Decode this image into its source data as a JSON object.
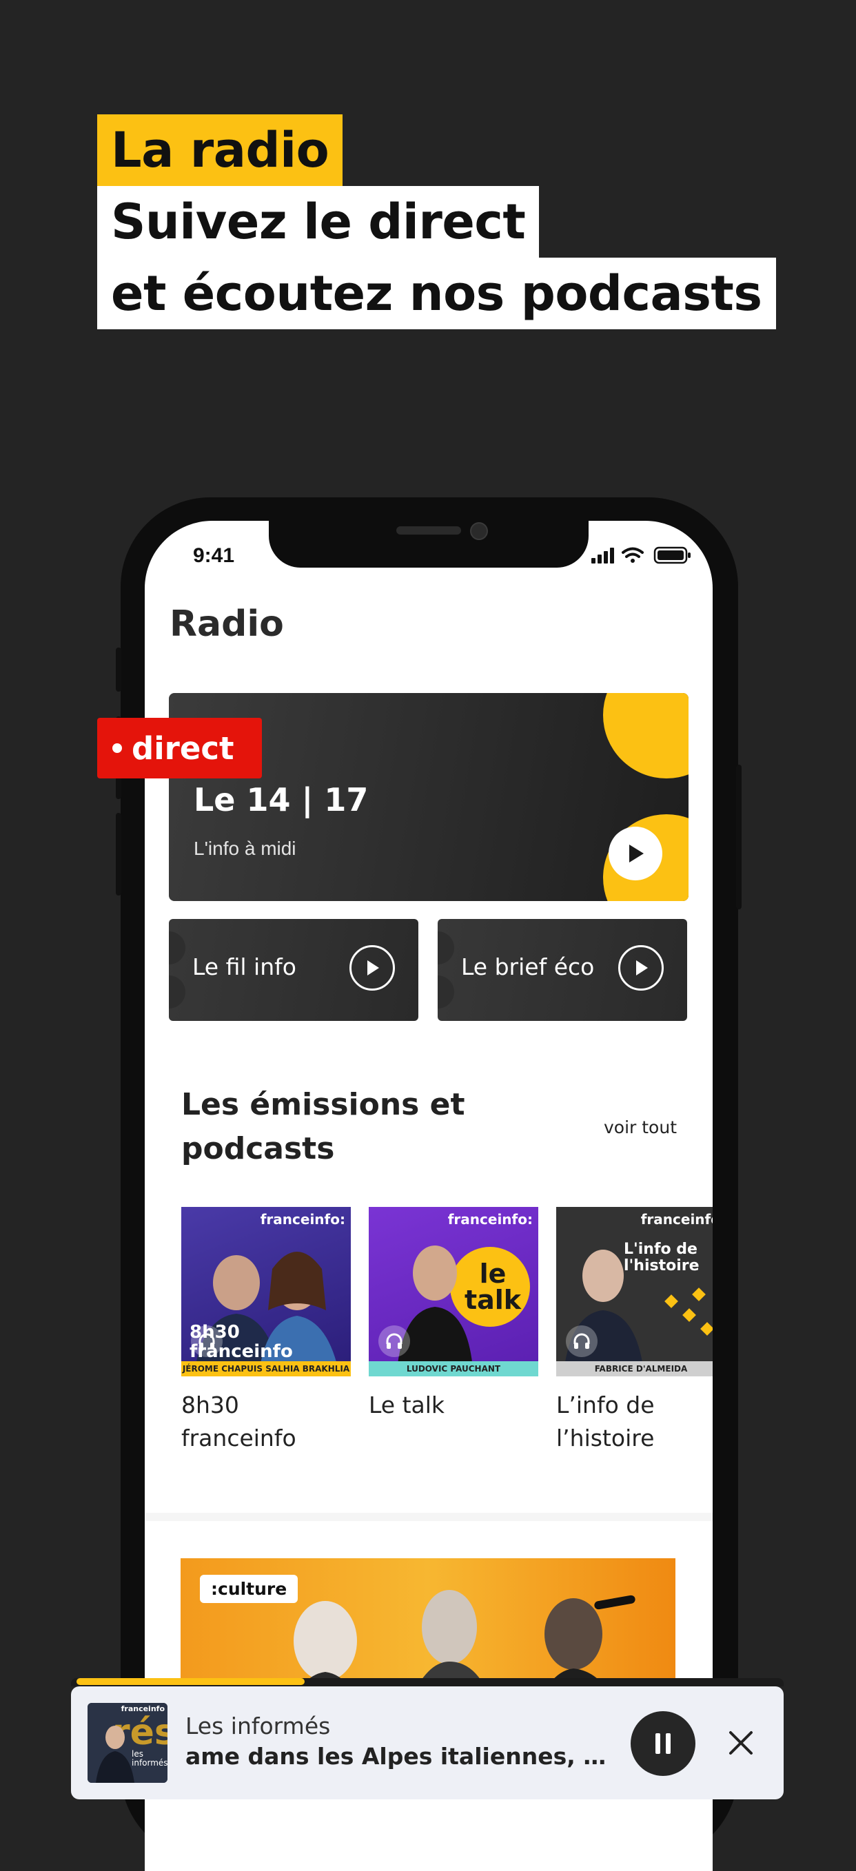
{
  "headline": {
    "line1": "La radio",
    "line2": "Suivez le direct",
    "line3": "et écoutez nos podcasts"
  },
  "status_bar": {
    "time": "9:41"
  },
  "page": {
    "title": "Radio"
  },
  "live": {
    "tag": "direct",
    "show_title": "Le 14 | 17",
    "subtitle": "L'info à midi"
  },
  "quick_streams": [
    {
      "label": "Le fil info"
    },
    {
      "label": "Le brief éco"
    }
  ],
  "podcasts_section": {
    "title": "Les émissions et podcasts",
    "see_all": "voir tout",
    "items": [
      {
        "label": "8h30 franceinfo",
        "brand": "franceinfo:",
        "cover_text": "8h30 franceinfo",
        "hosts": "JÉROME CHAPUIS   SALHIA BRAKHLIA",
        "cover_color": "#3a2a8c",
        "bar_color": "#fcc113"
      },
      {
        "label": "Le talk",
        "brand": "franceinfo:",
        "cover_text": "le talk",
        "hosts": "LUDOVIC PAUCHANT",
        "cover_color": "#6a2bc4",
        "bar_color": "#6fd8d0"
      },
      {
        "label": "L’info de l’histoire",
        "brand": "franceinfo",
        "cover_text": "L'info de l'histoire",
        "hosts": "FABRICE D'ALMEIDA",
        "cover_color": "#3a3a3a",
        "bar_color": "#cfcfcf"
      }
    ]
  },
  "culture_banner": {
    "chip": ":culture"
  },
  "player": {
    "show": "Les informés",
    "episode": "ame dans les Alpes italiennes, l'aff…",
    "thumb_brand": "franceinfo",
    "thumb_text": "les informés",
    "progress": 0.32
  },
  "colors": {
    "accent": "#fcc113",
    "live_red": "#e4140b",
    "dark": "#242424"
  }
}
